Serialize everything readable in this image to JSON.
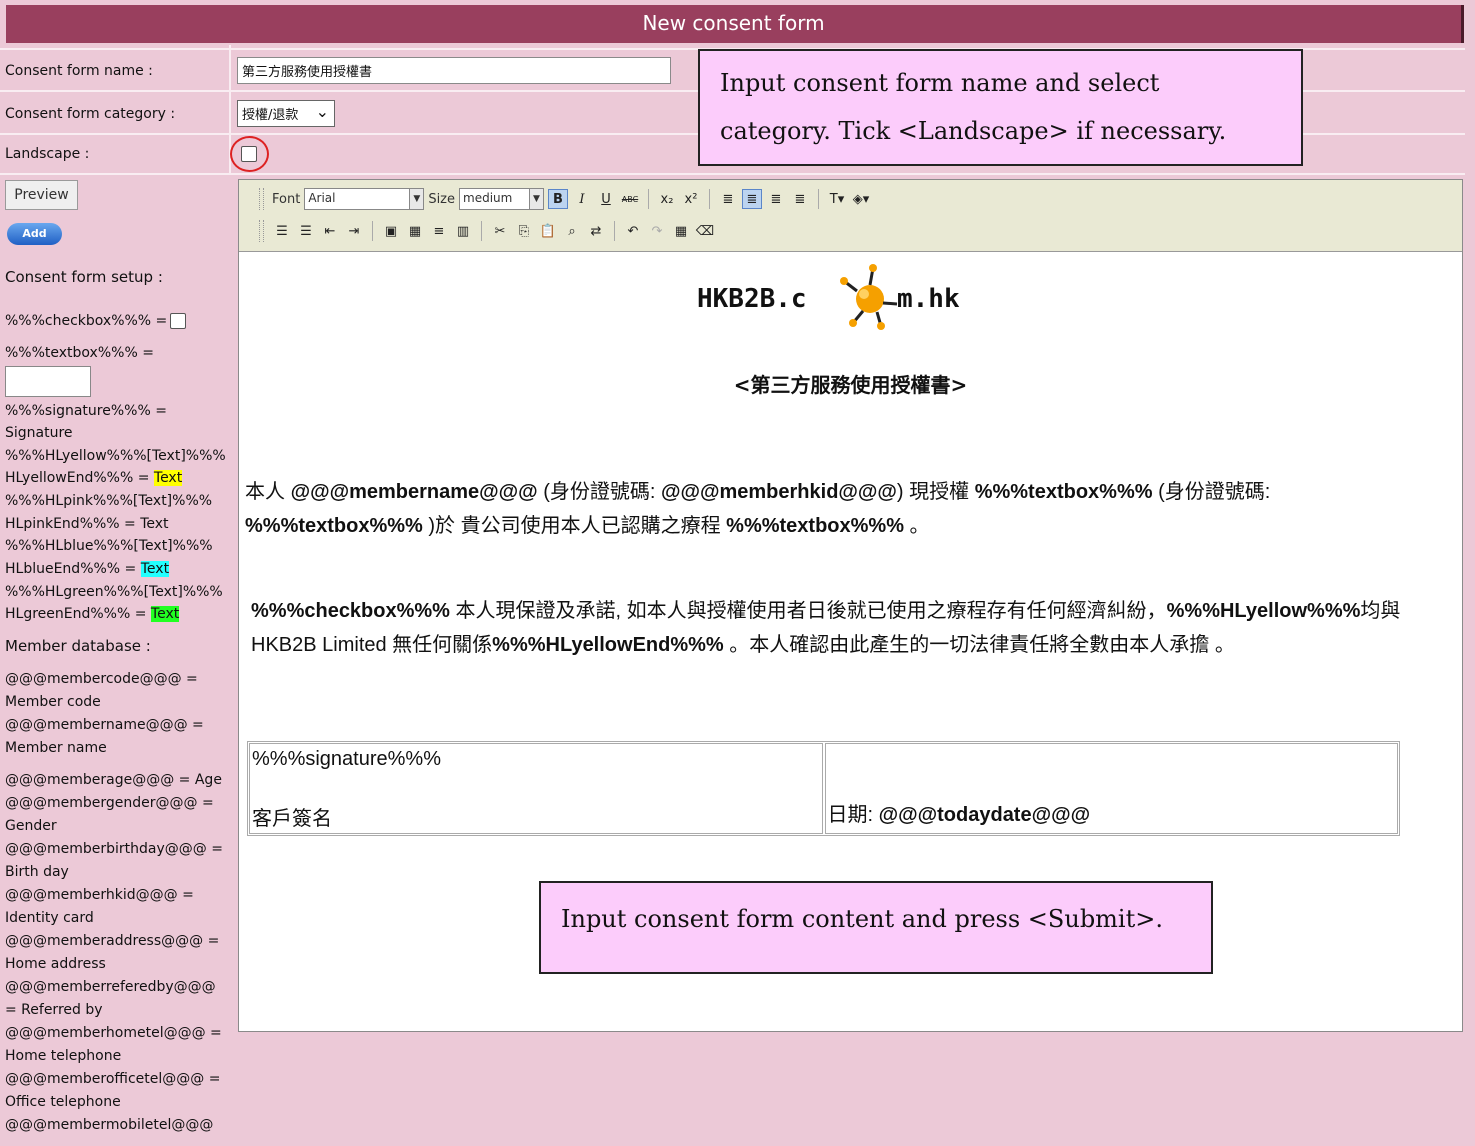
{
  "page": {
    "title": "New consent form"
  },
  "form": {
    "name_label": "Consent form name :",
    "name_value": "第三方服務使用授權書",
    "category_label": "Consent form category :",
    "category_value": "授權/退款",
    "landscape_label": "Landscape :"
  },
  "callouts": {
    "top_line1": "Input consent form name and select",
    "top_line2": "category. Tick <Landscape> if necessary.",
    "bottom": "Input consent form content and press <Submit>."
  },
  "sidebar": {
    "preview_label": "Preview",
    "add_label": "Add",
    "setup_heading": "Consent form setup :",
    "checkbox_tag": "%%%checkbox%%% =",
    "textbox_tag": "%%%textbox%%% =",
    "signature_tag": "%%%signature%%% =",
    "signature_desc": "Signature",
    "hlyellow_line1": "%%%HLyellow%%%[Text]%%%",
    "hlyellow_line2": "HLyellowEnd%%% =",
    "hlpink_line1": "%%%HLpink%%%[Text]%%%",
    "hlpink_line2": "HLpinkEnd%%% = Text",
    "hlblue_line1": "%%%HLblue%%%[Text]%%%",
    "hlblue_line2": "HLblueEnd%%% =",
    "hlgreen_line1": "%%%HLgreen%%%[Text]%%%",
    "hlgreen_line2": "HLgreenEnd%%% =",
    "hl_sample": "Text",
    "db_heading": "Member database :",
    "db_lines": [
      "@@@membercode@@@ =",
      "Member code",
      "@@@membername@@@ =",
      "Member name",
      "@@@memberage@@@ = Age",
      "@@@membergender@@@ =",
      "Gender",
      "@@@memberbirthday@@@ =",
      "Birth day",
      "@@@memberhkid@@@ =",
      "Identity card",
      "@@@memberaddress@@@ =",
      "Home address",
      "@@@memberreferedby@@@",
      "= Referred by",
      "@@@memberhometel@@@ =",
      "Home telephone",
      "@@@memberofficetel@@@ =",
      "Office telephone",
      "@@@membermobiletel@@@"
    ]
  },
  "toolbar": {
    "font_label": "Font",
    "font_value": "Arial",
    "size_label": "Size",
    "size_value": "medium"
  },
  "document": {
    "logo_text_left": "HKB2B.c",
    "logo_text_right": "m.hk",
    "title": "<第三方服務使用授權書>",
    "p1_a": "本人 ",
    "p1_b": "@@@membername@@@",
    "p1_c": " (身份證號碼: ",
    "p1_d": "@@@memberhkid@@@",
    "p1_e": ") 現授權 ",
    "p1_f": "%%%textbox%%%",
    "p1_g": " (身份證號碼: ",
    "p1_h": "%%%textbox%%%",
    "p1_i": " )於 貴公司使用本人已認購之療程 ",
    "p1_j": "%%%textbox%%%",
    "p1_k": " 。",
    "p2_a": "%%%checkbox%%%",
    "p2_b": " 本人現保證及承諾, 如本人與授權使用者日後就已使用之療程存有任何經濟糾紛，",
    "p2_c": "%%%HLyellow%%%",
    "p2_d": "均與HKB2B Limited 無任何關係",
    "p2_e": "%%%HLyellowEnd%%%",
    "p2_f": " 。本人確認由此產生的一切法律責任將全數由本人承擔 。",
    "sig_tag": "%%%signature%%%",
    "sig_label": "客戶簽名",
    "date_label": "日期: ",
    "date_tag": "@@@todaydate@@@"
  }
}
